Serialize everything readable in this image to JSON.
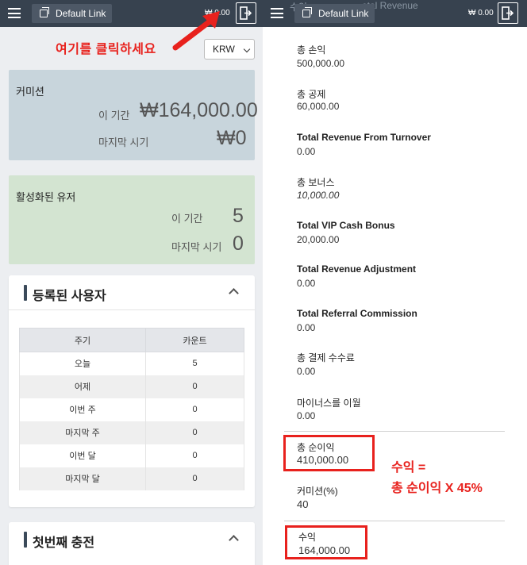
{
  "left": {
    "topbar": {
      "link_label": "Default Link",
      "balance": "₩ 0.00"
    },
    "annotation": "여기를 클릭하세요",
    "currency": {
      "selected": "KRW"
    },
    "commission": {
      "title": "커미션",
      "period_label": "이 기간",
      "period_value": "₩164,000.00",
      "last_label": "마지막 시기",
      "last_value": "₩0",
      "color": "#c8d5dc"
    },
    "active_users": {
      "title": "활성화된 유저",
      "period_label": "이 기간",
      "period_value": "5",
      "last_label": "마지막 시기",
      "last_value": "0",
      "color": "#d3e4d1"
    },
    "registered": {
      "title": "등록된 사용자",
      "columns": [
        "주기",
        "카운트"
      ],
      "rows": [
        [
          "오늘",
          "5"
        ],
        [
          "어제",
          "0"
        ],
        [
          "이번 주",
          "0"
        ],
        [
          "마지막 주",
          "0"
        ],
        [
          "이번 달",
          "0"
        ],
        [
          "마지막 달",
          "0"
        ]
      ]
    },
    "first_charge": {
      "title": "첫번째 충전"
    }
  },
  "right": {
    "topbar": {
      "link_label": "Default Link",
      "balance": "₩ 0.00",
      "ghost_left": "수익",
      "ghost_right": "otal Revenue"
    },
    "items": [
      {
        "label": "총 손익",
        "value": "500,000.00"
      },
      {
        "label": "총 공제",
        "value": "60,000.00"
      },
      {
        "label": "Total Revenue From Turnover",
        "value": "0.00"
      },
      {
        "label": "총 보너스",
        "value": "10,000.00"
      },
      {
        "label": "Total VIP Cash Bonus",
        "value": "20,000.00"
      },
      {
        "label": "Total Revenue Adjustment",
        "value": "0.00"
      },
      {
        "label": "Total Referral Commission",
        "value": "0.00"
      },
      {
        "label": "총 결제 수수료",
        "value": "0.00"
      },
      {
        "label": "마이너스를 이월",
        "value": "0.00"
      },
      {
        "label": "총 순이익",
        "value": "410,000.00"
      },
      {
        "label": "커미션(%)",
        "value": "40"
      },
      {
        "label": "수익",
        "value": "164,000.00"
      }
    ],
    "formula": {
      "line1": "수익 =",
      "line2": "총 순이익 X 45%"
    },
    "accent_red": "#e8211d"
  }
}
